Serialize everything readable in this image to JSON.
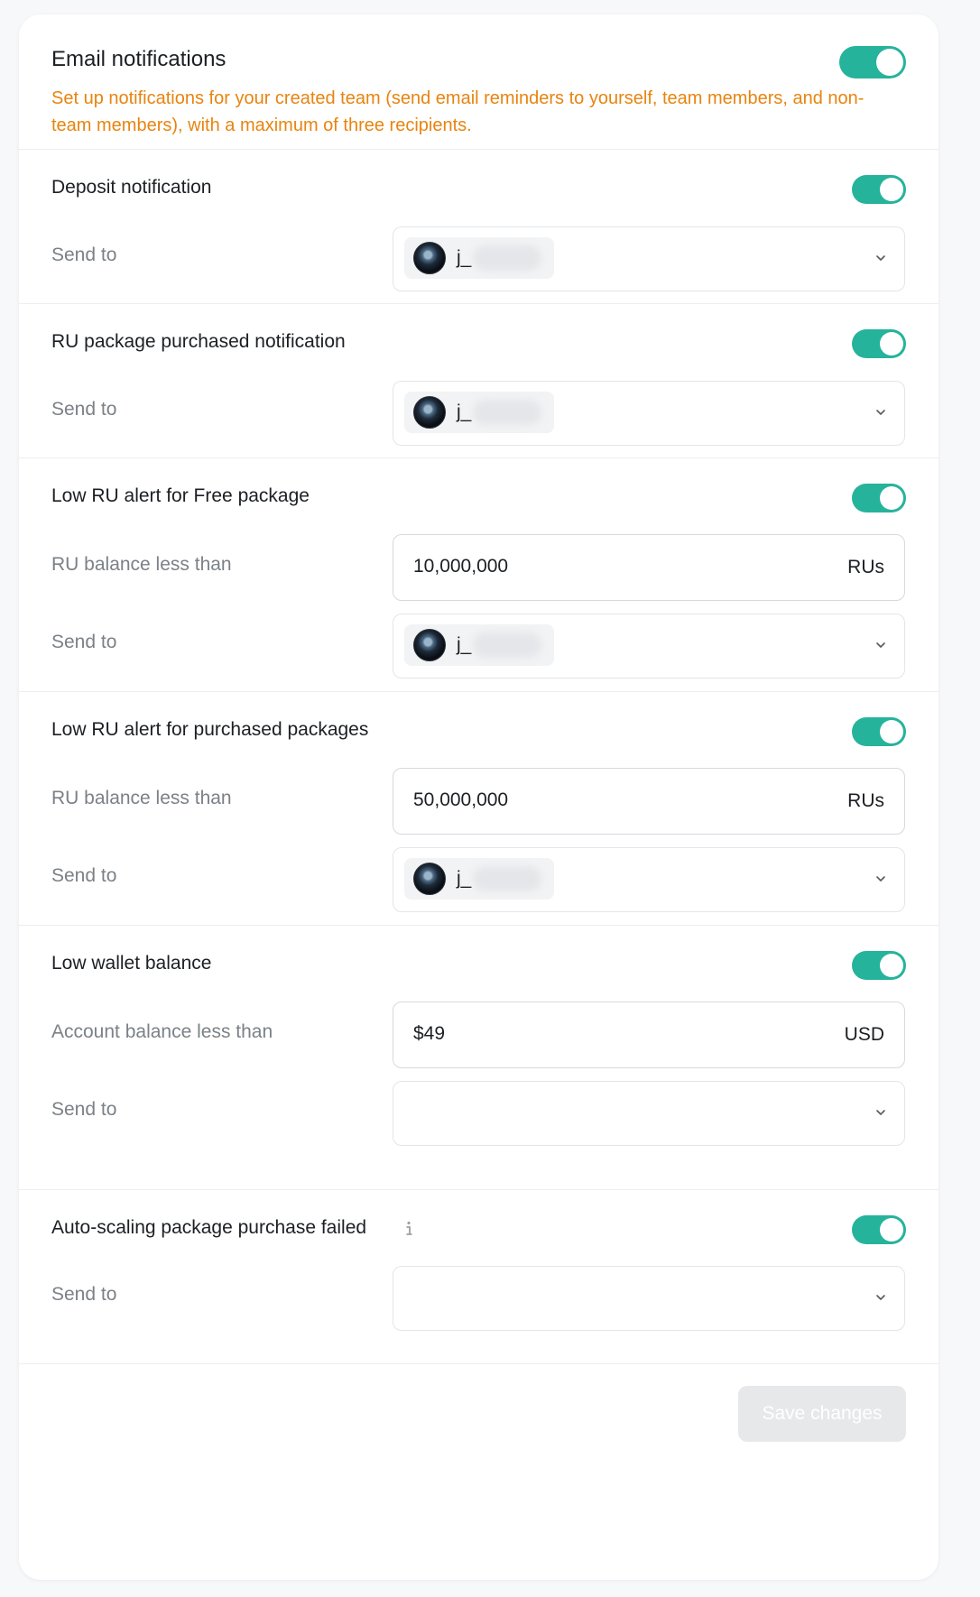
{
  "header": {
    "title": "Email notifications",
    "description": "Set up notifications for your created team (send email reminders to yourself, team members, and non-team members), with a maximum of three recipients.",
    "enabled": true
  },
  "sections": {
    "deposit": {
      "title": "Deposit notification",
      "enabled": true,
      "send_to_label": "Send to",
      "recipient": "j_",
      "recipient_avatar": "user-avatar"
    },
    "ru_package": {
      "title": "RU package purchased notification",
      "enabled": true,
      "send_to_label": "Send to",
      "recipient": "j_",
      "recipient_avatar": "user-avatar"
    },
    "low_ru_free": {
      "title": "Low RU alert for Free package",
      "enabled": true,
      "threshold_label": "RU balance less than",
      "threshold_value": "10,000,000",
      "threshold_unit": "RUs",
      "send_to_label": "Send to",
      "recipient": "j_",
      "recipient_avatar": "user-avatar"
    },
    "low_ru_purchased": {
      "title": "Low RU alert for purchased packages",
      "enabled": true,
      "threshold_label": "RU balance less than",
      "threshold_value": "50,000,000",
      "threshold_unit": "RUs",
      "send_to_label": "Send to",
      "recipient": "j_",
      "recipient_avatar": "user-avatar"
    },
    "low_wallet": {
      "title": "Low wallet balance",
      "enabled": true,
      "threshold_label": "Account balance less than",
      "threshold_value": "$49",
      "threshold_unit": "USD",
      "send_to_label": "Send to",
      "recipient": ""
    },
    "auto_scaling": {
      "title": "Auto-scaling package purchase failed",
      "enabled": true,
      "send_to_label": "Send to",
      "recipient": "",
      "info_icon": "info-icon"
    }
  },
  "footer": {
    "save_label": "Save changes",
    "save_disabled": true
  },
  "colors": {
    "accent": "#26b39b",
    "warning_text": "#e8840f",
    "muted_label": "#7b8187",
    "disabled_button": "#e6e8ea"
  },
  "icons": {
    "select_chevron": "chevron-down-icon",
    "info": "info-icon"
  }
}
